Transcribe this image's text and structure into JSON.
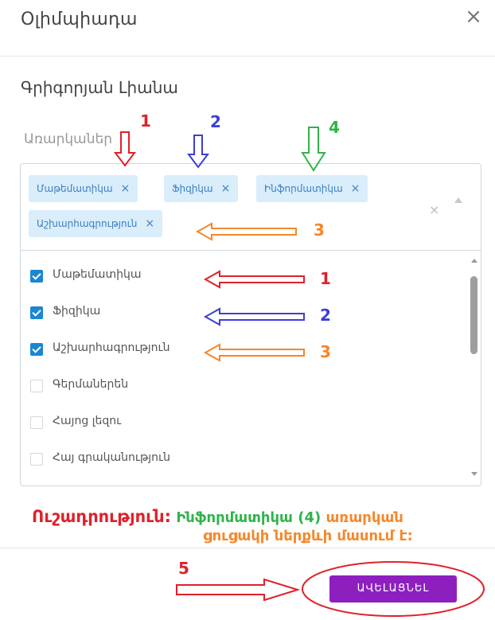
{
  "modal": {
    "title": "Օլիմպիադա",
    "close_icon": "close-icon"
  },
  "student": {
    "name": "Գրիգորյան Լիանա"
  },
  "subjects_field": {
    "label": "Առարկաներ",
    "selected_tags": [
      {
        "label": "Մաթեմատիկա"
      },
      {
        "label": "Ֆիզիկա"
      },
      {
        "label": "Ինֆորմատիկա"
      },
      {
        "label": "Աշխարհագրություն"
      }
    ],
    "tag_remove_glyph": "×",
    "clear_glyph": "×"
  },
  "options": [
    {
      "label": "Մաթեմատիկա",
      "checked": true
    },
    {
      "label": "Ֆիզիկա",
      "checked": true
    },
    {
      "label": "Աշխարհագրություն",
      "checked": true
    },
    {
      "label": "Գերմաներեն",
      "checked": false
    },
    {
      "label": "Հայոց լեզու",
      "checked": false
    },
    {
      "label": "Հայ գրականություն",
      "checked": false
    }
  ],
  "notice": {
    "heading": "Ուշադրություն:",
    "subject": "Ինֆորմատիկա (4)",
    "text_part1": "առարկան",
    "text_part2": "ցուցակի ներքևի մասում է:"
  },
  "footer": {
    "add_button_label": "ԱՎԵԼԱՑՆԵԼ"
  },
  "annotations": {
    "numbers": [
      "1",
      "2",
      "3",
      "4",
      "5"
    ],
    "colors": {
      "red": "#e0202a",
      "blue": "#3b3fd6",
      "green": "#2fb34a",
      "orange": "#f5872b"
    }
  }
}
